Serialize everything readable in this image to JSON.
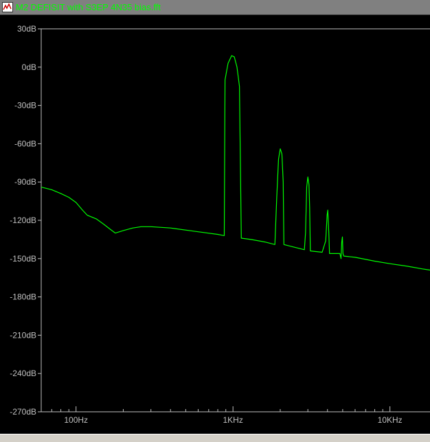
{
  "window": {
    "title": "M2 DEFISIT with S3EP 4N35 bias.fft",
    "icon": "waveform-viewer-icon"
  },
  "colors": {
    "trace": "#00ff00",
    "axis": "#c0c0c0",
    "background": "#000000"
  },
  "chart_data": {
    "type": "line",
    "xscale": "log",
    "xlim": [
      60,
      18000
    ],
    "ylim": [
      -270,
      30
    ],
    "x_ticks": [
      {
        "value": 100,
        "label": "100Hz"
      },
      {
        "value": 1000,
        "label": "1KHz"
      },
      {
        "value": 10000,
        "label": "10KHz"
      }
    ],
    "y_ticks": [
      {
        "value": 30,
        "label": "30dB"
      },
      {
        "value": 0,
        "label": "0dB"
      },
      {
        "value": -30,
        "label": "-30dB"
      },
      {
        "value": -60,
        "label": "-60dB"
      },
      {
        "value": -90,
        "label": "-90dB"
      },
      {
        "value": -120,
        "label": "-120dB"
      },
      {
        "value": -150,
        "label": "-150dB"
      },
      {
        "value": -180,
        "label": "-180dB"
      },
      {
        "value": -210,
        "label": "-210dB"
      },
      {
        "value": -240,
        "label": "-240dB"
      },
      {
        "value": -270,
        "label": "-270dB"
      }
    ],
    "grid": false,
    "series": [
      {
        "color": "#00ff00",
        "points": [
          [
            60,
            -94
          ],
          [
            70,
            -96
          ],
          [
            80,
            -99
          ],
          [
            90,
            -102
          ],
          [
            100,
            -106
          ],
          [
            110,
            -112
          ],
          [
            118,
            -116
          ],
          [
            135,
            -119
          ],
          [
            150,
            -123
          ],
          [
            165,
            -127
          ],
          [
            178,
            -130
          ],
          [
            200,
            -128
          ],
          [
            230,
            -126
          ],
          [
            260,
            -125
          ],
          [
            300,
            -125
          ],
          [
            400,
            -126
          ],
          [
            600,
            -129
          ],
          [
            800,
            -131
          ],
          [
            880,
            -132
          ],
          [
            890,
            -10
          ],
          [
            930,
            3
          ],
          [
            980,
            9
          ],
          [
            1020,
            8
          ],
          [
            1060,
            0
          ],
          [
            1100,
            -15
          ],
          [
            1130,
            -134
          ],
          [
            1300,
            -135
          ],
          [
            1600,
            -137
          ],
          [
            1850,
            -139
          ],
          [
            1900,
            -102
          ],
          [
            1950,
            -72
          ],
          [
            2000,
            -64
          ],
          [
            2050,
            -68
          ],
          [
            2090,
            -90
          ],
          [
            2110,
            -139
          ],
          [
            2450,
            -141
          ],
          [
            2850,
            -143
          ],
          [
            2900,
            -130
          ],
          [
            2950,
            -94
          ],
          [
            3000,
            -86
          ],
          [
            3050,
            -92
          ],
          [
            3080,
            -110
          ],
          [
            3110,
            -144
          ],
          [
            3700,
            -145
          ],
          [
            3900,
            -136
          ],
          [
            3980,
            -116
          ],
          [
            4020,
            -112
          ],
          [
            4080,
            -130
          ],
          [
            4120,
            -146
          ],
          [
            4800,
            -146
          ],
          [
            4880,
            -150
          ],
          [
            4930,
            -137
          ],
          [
            4980,
            -133
          ],
          [
            5020,
            -146
          ],
          [
            5080,
            -148
          ],
          [
            6000,
            -149
          ],
          [
            8000,
            -152
          ],
          [
            10000,
            -154
          ],
          [
            13000,
            -156
          ],
          [
            16000,
            -158
          ],
          [
            18000,
            -159
          ]
        ]
      }
    ]
  }
}
